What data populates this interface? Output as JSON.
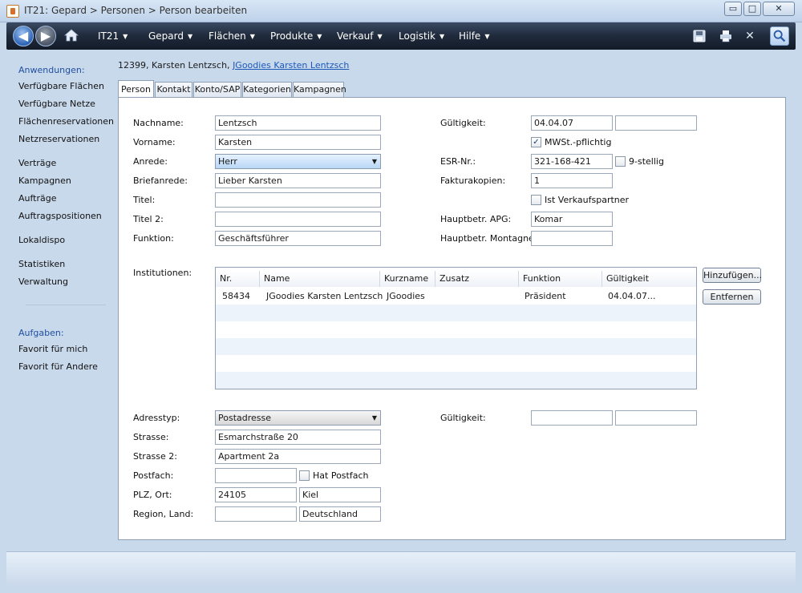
{
  "window": {
    "title": "IT21: Gepard > Personen > Person bearbeiten",
    "min_glyph": "▭",
    "max_glyph": "□",
    "close_glyph": "✕"
  },
  "toolbar": {
    "back_glyph": "◀",
    "forward_glyph": "▶",
    "menus": [
      {
        "label": "IT21"
      },
      {
        "label": "Gepard"
      },
      {
        "label": "Flächen"
      },
      {
        "label": "Produkte"
      },
      {
        "label": "Verkauf"
      },
      {
        "label": "Logistik"
      },
      {
        "label": "Hilfe"
      }
    ],
    "caret": "▼",
    "icons": {
      "save": "save-icon",
      "print": "print-icon",
      "close": "close-icon",
      "search": "search-icon"
    },
    "close_glyph": "✕"
  },
  "sidebar": {
    "apps_heading": "Anwendungen:",
    "apps": [
      "Verfügbare Flächen",
      "Verfügbare Netze",
      "Flächenreservationen",
      "Netzreservationen",
      "Verträge",
      "Kampagnen",
      "Aufträge",
      "Auftragspositionen",
      "Lokaldispo",
      "Statistiken",
      "Verwaltung"
    ],
    "tasks_heading": "Aufgaben:",
    "tasks": [
      "Favorit für mich",
      "Favorit für Andere"
    ]
  },
  "header": {
    "record_prefix": "12399, Karsten Lentzsch,",
    "record_link": "JGoodies Karsten Lentzsch"
  },
  "tabs": [
    "Person",
    "Kontakt",
    "Konto/SAP",
    "Kategorien",
    "Kampagnen"
  ],
  "form": {
    "nachname": {
      "label": "Nachname:",
      "value": "Lentzsch"
    },
    "vorname": {
      "label": "Vorname:",
      "value": "Karsten"
    },
    "anrede": {
      "label": "Anrede:",
      "value": "Herr"
    },
    "briefanrede": {
      "label": "Briefanrede:",
      "value": "Lieber Karsten"
    },
    "titel": {
      "label": "Titel:",
      "value": ""
    },
    "titel2": {
      "label": "Titel 2:",
      "value": ""
    },
    "funktion": {
      "label": "Funktion:",
      "value": "Geschäftsführer"
    },
    "gueltigkeit": {
      "label": "Gültigkeit:",
      "from": "04.04.07",
      "to": ""
    },
    "mwst": {
      "label": "MWSt.-pflichtig",
      "checked": true
    },
    "esr": {
      "label": "ESR-Nr.:",
      "value": "321-168-421"
    },
    "neunstellig": {
      "label": "9-stellig",
      "checked": false
    },
    "fakturakopien": {
      "label": "Fakturakopien:",
      "value": "1"
    },
    "verkaufspartner": {
      "label": "Ist Verkaufspartner",
      "checked": false
    },
    "hauptbetr_apg": {
      "label": "Hauptbetr. APG:",
      "value": "Komar"
    },
    "hauptbetr_montagne": {
      "label": "Hauptbetr. Montagne:",
      "value": ""
    }
  },
  "institutionen": {
    "label": "Institutionen:",
    "columns": [
      "Nr.",
      "Name",
      "Kurzname",
      "Zusatz",
      "Funktion",
      "Gültigkeit"
    ],
    "rows": [
      [
        "58434",
        "JGoodies Karsten Lentzsch",
        "JGoodies",
        "",
        "Präsident",
        "04.04.07..."
      ]
    ],
    "add_label": "Hinzufügen...",
    "remove_label": "Entfernen"
  },
  "address": {
    "adresstyp": {
      "label": "Adresstyp:",
      "value": "Postadresse"
    },
    "gueltigkeit": {
      "label": "Gültigkeit:",
      "from": "",
      "to": ""
    },
    "strasse": {
      "label": "Strasse:",
      "value": "Esmarchstraße 20"
    },
    "strasse2": {
      "label": "Strasse 2:",
      "value": "Apartment 2a"
    },
    "postfach": {
      "label": "Postfach:",
      "value": ""
    },
    "hat_postfach": {
      "label": "Hat Postfach",
      "checked": false
    },
    "plz_ort": {
      "label": "PLZ, Ort:",
      "plz": "24105",
      "ort": "Kiel"
    },
    "region_land": {
      "label": "Region, Land:",
      "region": "",
      "land": "Deutschland"
    }
  },
  "checkmark": "✓"
}
